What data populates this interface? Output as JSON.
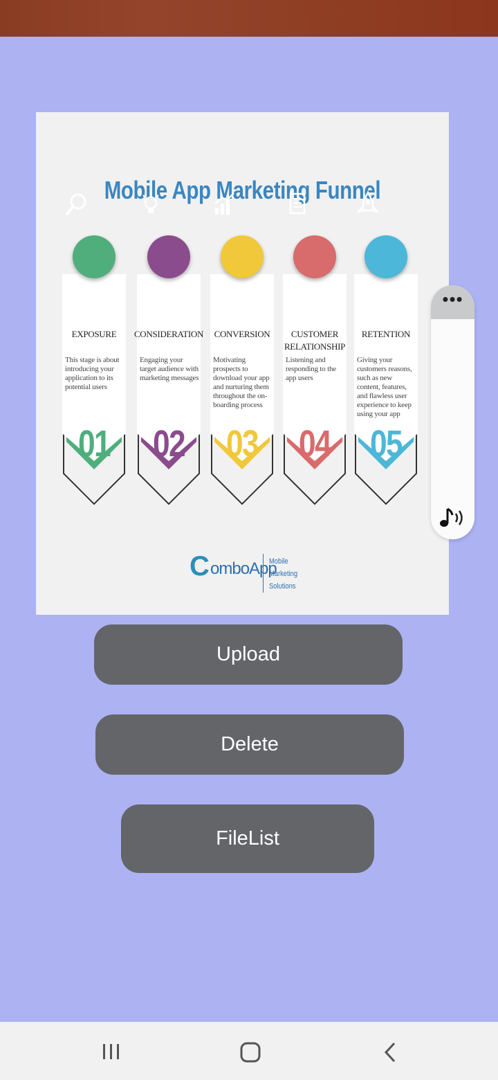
{
  "infographic": {
    "title": "Mobile App Marketing Funnel",
    "stages": [
      {
        "name": "EXPOSURE",
        "desc": "This stage is about introducing your application to its potential users",
        "num": "01",
        "color": "#4fae7c",
        "icon": "magnifier-icon"
      },
      {
        "name": "CONSIDERATION",
        "desc": "Engaging your target audience with marketing messages",
        "num": "02",
        "color": "#8a4c8c",
        "icon": "lightbulb-icon"
      },
      {
        "name": "CONVERSION",
        "desc": "Motivating prospects to download your app and nurturing them throughout the on-boarding process",
        "num": "03",
        "color": "#f1c83a",
        "icon": "growth-chart-icon"
      },
      {
        "name": "CUSTOMER RELATIONSHIP",
        "desc": "Listening and responding to the app users",
        "num": "04",
        "color": "#d86b6b",
        "icon": "document-icon"
      },
      {
        "name": "RETENTION",
        "desc": "Giving your customers reasons, such as new content, features, and flawless user experience to keep using your app",
        "num": "05",
        "color": "#4cb7d8",
        "icon": "rocket-icon"
      }
    ],
    "logo": {
      "brand": "omboApp",
      "mark": "C",
      "tagline_1": "Mobile",
      "tagline_2": "Marketing",
      "tagline_3": "Solutions"
    }
  },
  "buttons": {
    "upload": "Upload",
    "delete": "Delete",
    "filelist": "FileList"
  },
  "float_panel": {
    "menu_icon": "more-dots-icon",
    "audio_icon": "music-speaker-icon",
    "menu_label": "•••"
  },
  "nav": {
    "recents": "recents-icon",
    "home": "home-icon",
    "back": "back-icon"
  }
}
